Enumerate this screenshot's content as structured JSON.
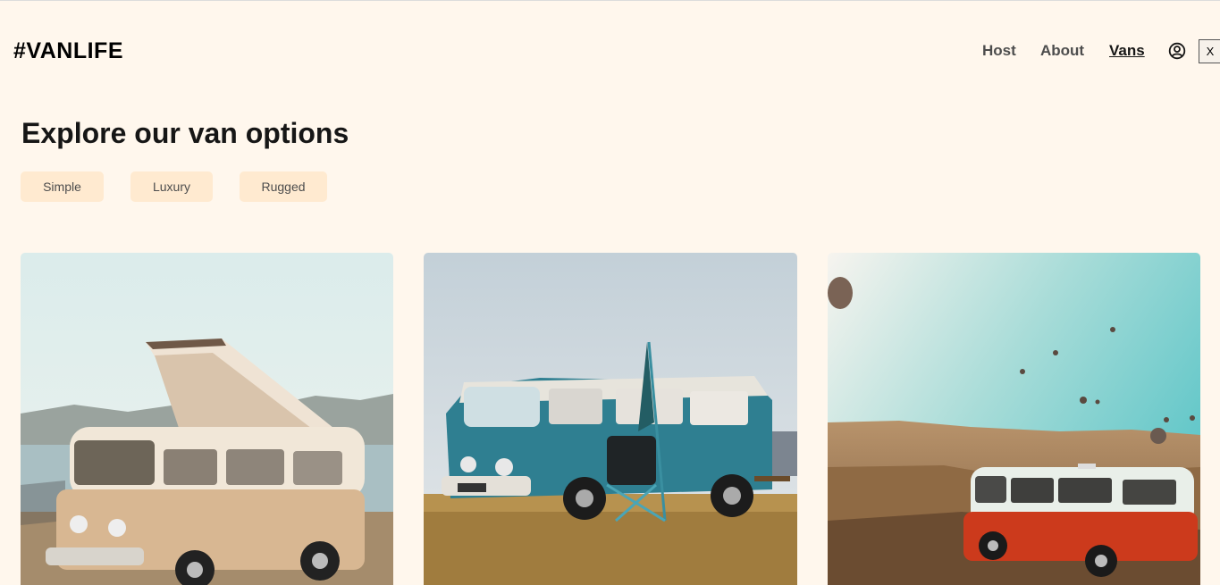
{
  "header": {
    "logo": "#VANLIFE",
    "nav": [
      {
        "label": "Host",
        "active": false
      },
      {
        "label": "About",
        "active": false
      },
      {
        "label": "Vans",
        "active": true
      }
    ],
    "user_icon": "user-circle-icon",
    "close_label": "X"
  },
  "main": {
    "title": "Explore our van options",
    "filters": [
      "Simple",
      "Luxury",
      "Rugged"
    ],
    "vans": [
      {
        "image": "beige-camper-van-by-lake-photo"
      },
      {
        "image": "teal-van-with-camping-chair-photo"
      },
      {
        "image": "red-van-with-hot-air-balloons-photo"
      }
    ]
  },
  "colors": {
    "background": "#FFF7ED",
    "filter_bg": "#FFEAD0",
    "text_dark": "#161616",
    "nav_text": "#4D4D4D"
  }
}
